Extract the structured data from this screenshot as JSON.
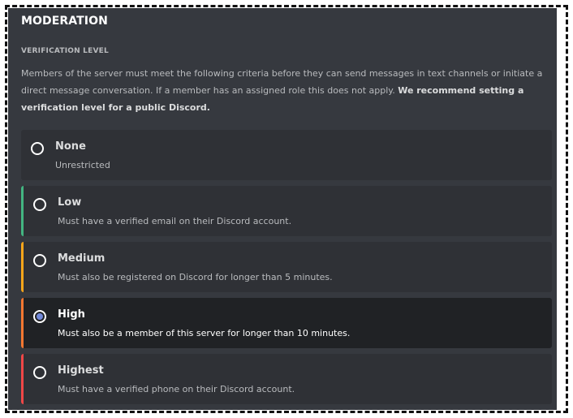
{
  "title": "MODERATION",
  "section_label": "VERIFICATION LEVEL",
  "description": {
    "text": "Members of the server must meet the following criteria before they can send messages in text channels or initiate a direct message conversation. If a member has an assigned role this does not apply.",
    "bold": "We recommend setting a verification level for a public Discord."
  },
  "options": [
    {
      "label": "None",
      "desc": "Unrestricted",
      "accent": "",
      "selected": false
    },
    {
      "label": "Low",
      "desc": "Must have a verified email on their Discord account.",
      "accent": "#43b581",
      "selected": false
    },
    {
      "label": "Medium",
      "desc": "Must also be registered on Discord for longer than 5 minutes.",
      "accent": "#faa61a",
      "selected": false
    },
    {
      "label": "High",
      "desc": "Must also be a member of this server for longer than 10 minutes.",
      "accent": "#f57731",
      "selected": true
    },
    {
      "label": "Highest",
      "desc": "Must have a verified phone on their Discord account.",
      "accent": "#f04747",
      "selected": false
    }
  ],
  "colors": {
    "background": "#36393f",
    "option_background": "#2f3136",
    "selected_background": "#202225",
    "radio_selected": "#7289da"
  }
}
